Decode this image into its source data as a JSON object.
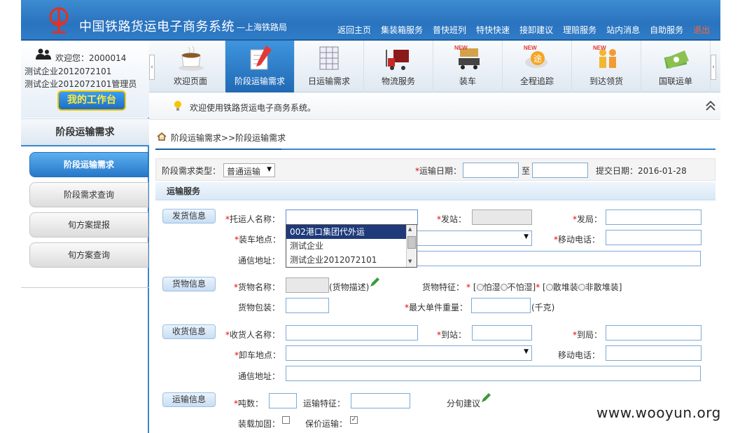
{
  "header": {
    "title": "中国铁路货运电子商务系统",
    "subtitle": "—上海铁路局",
    "nav": [
      "返回主页",
      "集装箱服务",
      "普快班列",
      "特快快速",
      "接卸建议",
      "理赔服务",
      "站内消息",
      "自助服务",
      "退出"
    ]
  },
  "user": {
    "welcome": "欢迎您：2000014",
    "company": "测试企业2012072101",
    "admin": "测试企业2012072101管理员",
    "workbench": "我的工作台"
  },
  "sidebar": {
    "section_title": "阶段运输需求",
    "items": [
      "阶段运输需求",
      "阶段需求查询",
      "旬方案提报",
      "旬方案查询"
    ]
  },
  "toolbar": {
    "items": [
      "欢迎页面",
      "阶段运输需求",
      "日运输需求",
      "物流服务",
      "装车",
      "全程追踪",
      "到达领货",
      "国联运单"
    ],
    "new_badge": "NEW"
  },
  "notice": "欢迎使用铁路货运电子商务系统。",
  "breadcrumb": "阶段运输需求>>阶段运输需求",
  "form": {
    "type_label": "阶段需求类型：",
    "type_value": "普通运输",
    "ship_date_label": "运输日期：",
    "to": "至",
    "submit_date": "提交日期：2016-01-28",
    "service_bar": "运输服务",
    "groups": {
      "shipper": "发货信息",
      "goods": "货物信息",
      "consignee": "收货信息",
      "transport": "运输信息"
    },
    "labels": {
      "shipper_name": "托运人名称：",
      "from_station": "发站：",
      "from_bureau": "发局：",
      "load_place": "装车地点：",
      "mobile": "移动电话：",
      "address": "通信地址：",
      "goods_name": "货物名称：",
      "goods_desc": "(货物描述)",
      "goods_feature": "货物特征：",
      "fear_wet": "怕湿",
      "no_fear_wet": "不怕湿",
      "bulk": "散堆装",
      "non_bulk": "非散堆装",
      "packing": "货物包装：",
      "max_weight": "最大单件重量：",
      "kg": "(千克)",
      "consignee_name": "收货人名称：",
      "to_station": "到站：",
      "to_bureau": "到局：",
      "unload_place": "卸车地点：",
      "tons": "吨数：",
      "transport_feature": "运输特征：",
      "ten_day": "分旬建议",
      "reinforce": "装载加固：",
      "insured": "保价运输："
    },
    "dropdown_options": [
      "002港口集团代外运",
      "测试企业",
      "测试企业2012072101"
    ]
  },
  "watermark": "www.wooyun.org"
}
